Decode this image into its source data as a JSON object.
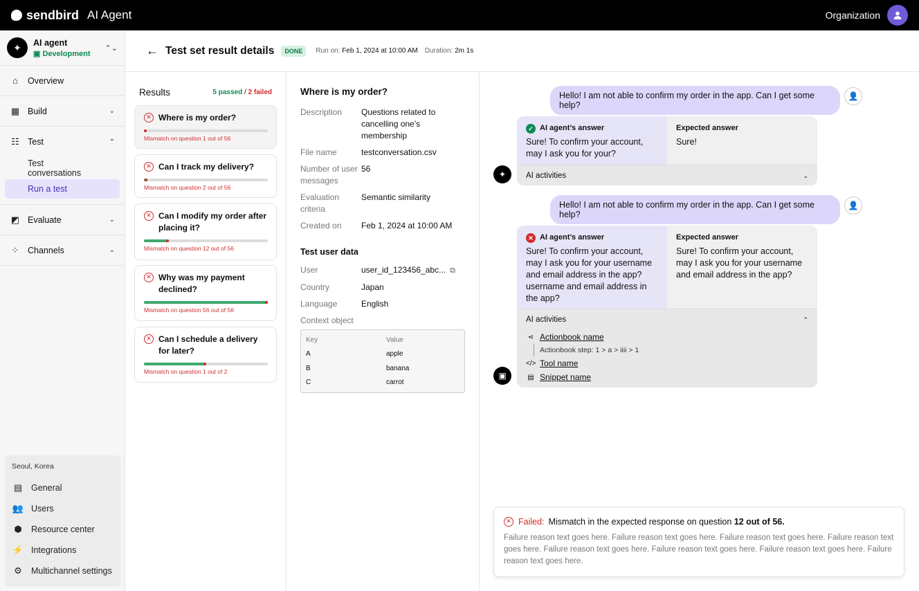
{
  "topbar": {
    "brand": "sendbird",
    "product": "AI Agent",
    "org": "Organization"
  },
  "agent": {
    "name": "AI agent",
    "env": "Development"
  },
  "nav": {
    "overview": "Overview",
    "build": "Build",
    "test": "Test",
    "test_conversations": "Test conversations",
    "run_a_test": "Run a test",
    "evaluate": "Evaluate",
    "channels": "Channels"
  },
  "bottom": {
    "location": "Seoul, Korea",
    "general": "General",
    "users": "Users",
    "resource_center": "Resource center",
    "integrations": "Integrations",
    "multichannel": "Multichannel settings"
  },
  "header": {
    "title": "Test set result details",
    "status": "DONE",
    "run_on_label": "Run on:",
    "run_on": "Feb 1, 2024 at 10:00 AM",
    "duration_label": "Duration:",
    "duration": "2m 1s"
  },
  "results": {
    "title": "Results",
    "passed": "5 passed",
    "sep": " / ",
    "failed": "2 failed",
    "items": [
      {
        "question": "Where is my order?",
        "mismatch": "Mismatch on question 1 out of 56",
        "progress": 0.0
      },
      {
        "question": "Can I track my delivery?",
        "mismatch": "Mismatch on question 2 out of 56",
        "progress": 0.03
      },
      {
        "question": "Can I modify my order after placing it?",
        "mismatch": "Mismatch on question 12 out of 56",
        "progress": 0.2
      },
      {
        "question": "Why was my payment declined?",
        "mismatch": "Mismatch on question 56 out of 56",
        "progress": 1.0
      },
      {
        "question": "Can I schedule a delivery for later?",
        "mismatch": "Mismatch on question 1 out of 2",
        "progress": 0.5
      }
    ]
  },
  "detail": {
    "title": "Where is my order?",
    "description_label": "Description",
    "description": "Questions related to cancelling one’s membership",
    "file_label": "File name",
    "file": "testconversation.csv",
    "count_label": "Number of user messages",
    "count": "56",
    "criteria_label": "Evaluation criteria",
    "criteria": "Semantic similarity",
    "created_label": "Created on",
    "created": "Feb 1, 2024 at 10:00 AM",
    "user_data_title": "Test user data",
    "user_label": "User",
    "user": "user_id_123456_abc...",
    "country_label": "Country",
    "country": "Japan",
    "language_label": "Language",
    "language": "English",
    "context_label": "Context object",
    "ctx_key": "Key",
    "ctx_value": "Value",
    "ctx_rows": [
      {
        "k": "A",
        "v": "apple"
      },
      {
        "k": "B",
        "v": "banana"
      },
      {
        "k": "C",
        "v": "carrot"
      }
    ]
  },
  "chat": {
    "user_msg_1": "Hello! I am not able to confirm my order in the app. Can I get some help?",
    "answer1_label": "AI agent’s answer",
    "answer1": "Sure! To confirm your account, may I ask you for your?",
    "expected1_label": "Expected answer",
    "expected1": "Sure!",
    "activities_label": "AI activities",
    "user_msg_2": "Hello! I am not able to confirm my order in the app. Can I get some help?",
    "answer2_label": "AI agent’s answer",
    "answer2": "Sure! To confirm your account, may I ask you for your username and email address in the app? username and email address in the app?",
    "expected2_label": "Expected answer",
    "expected2": "Sure! To confirm your account, may I ask you for your username and email address in the app?",
    "activities2_label": "AI activities",
    "actionbook": "Actionbook name",
    "actionbook_step": "Actionbook step: 1 > a > iiii > 1",
    "tool": "Tool name",
    "snippet": "Snippet name"
  },
  "failure": {
    "label": "Failed:",
    "message": "Mismatch in the expected response on question",
    "question": "12 out of 56.",
    "reason": "Failure reason text goes here. Failure reason text goes here. Failure reason text goes here. Failure reason text goes here. Failure reason text goes here. Failure reason text goes here. Failure reason text goes here. Failure reason text goes here."
  },
  "colors": {
    "accent": "#6e5bd8",
    "pass": "#0d8a55",
    "fail": "#d12c2c",
    "user_bubble": "#dcd6fb"
  }
}
